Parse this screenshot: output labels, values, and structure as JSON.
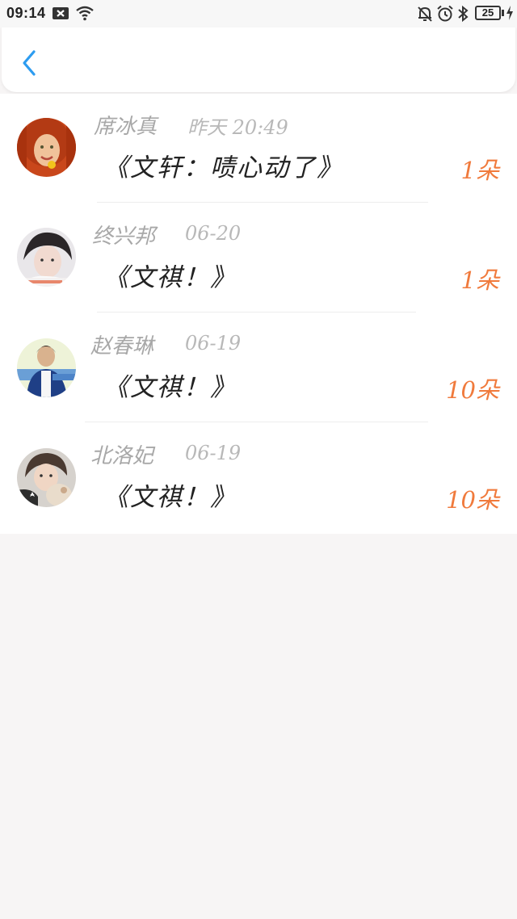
{
  "status_bar": {
    "time": "09:14",
    "battery": "25",
    "icons": [
      "notification-close-icon",
      "wifi-icon",
      "mute-bell-icon",
      "alarm-icon",
      "bluetooth-icon",
      "battery-icon",
      "charging-bolt-icon"
    ]
  },
  "header": {
    "back_icon": "chevron-left-icon",
    "accent": "#2d9cf0"
  },
  "colors": {
    "name": "#a8a8a8",
    "time": "#b8b8b8",
    "message": "#222222",
    "count": "#f07a3c"
  },
  "items": [
    {
      "name": "席冰真",
      "time": "昨天 20:49",
      "message": "《文轩：啧心动了》",
      "count": "1朵"
    },
    {
      "name": "终兴邦",
      "time": "06-20",
      "message": "《文祺！》",
      "count": "1朵"
    },
    {
      "name": "赵春琳",
      "time": "06-19",
      "message": "《文祺！》",
      "count": "10朵"
    },
    {
      "name": "北洛妃",
      "time": "06-19",
      "message": "《文祺！》",
      "count": "10朵"
    }
  ]
}
